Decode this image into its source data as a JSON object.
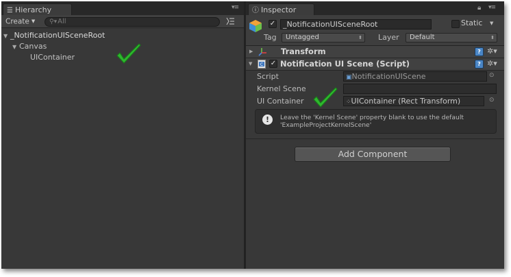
{
  "hierarchy": {
    "tab_label": "Hierarchy",
    "create_label": "Create",
    "search_placeholder": "All",
    "items": [
      {
        "label": "_NotificationUISceneRoot"
      },
      {
        "label": "Canvas"
      },
      {
        "label": "UIContainer"
      }
    ]
  },
  "inspector": {
    "tab_label": "Inspector",
    "object_name": "_NotificationUISceneRoot",
    "static_label": "Static",
    "tag_label": "Tag",
    "tag_value": "Untagged",
    "layer_label": "Layer",
    "layer_value": "Default",
    "transform_title": "Transform",
    "script_component_title": "Notification UI Scene (Script)",
    "fields": [
      {
        "label": "Script",
        "value": "NotificationUIScene"
      },
      {
        "label": "Kernel Scene",
        "value": ""
      },
      {
        "label": "UI Container",
        "value": "UIContainer (Rect Transform)"
      }
    ],
    "help_message": "Leave the 'Kernel Scene' property blank to use the default 'ExampleProjectKernelScene'",
    "add_component_label": "Add Component"
  },
  "colors": {
    "panel_bg": "#383838",
    "check_green": "#2eb82e",
    "help_blue": "#4a86c6"
  }
}
